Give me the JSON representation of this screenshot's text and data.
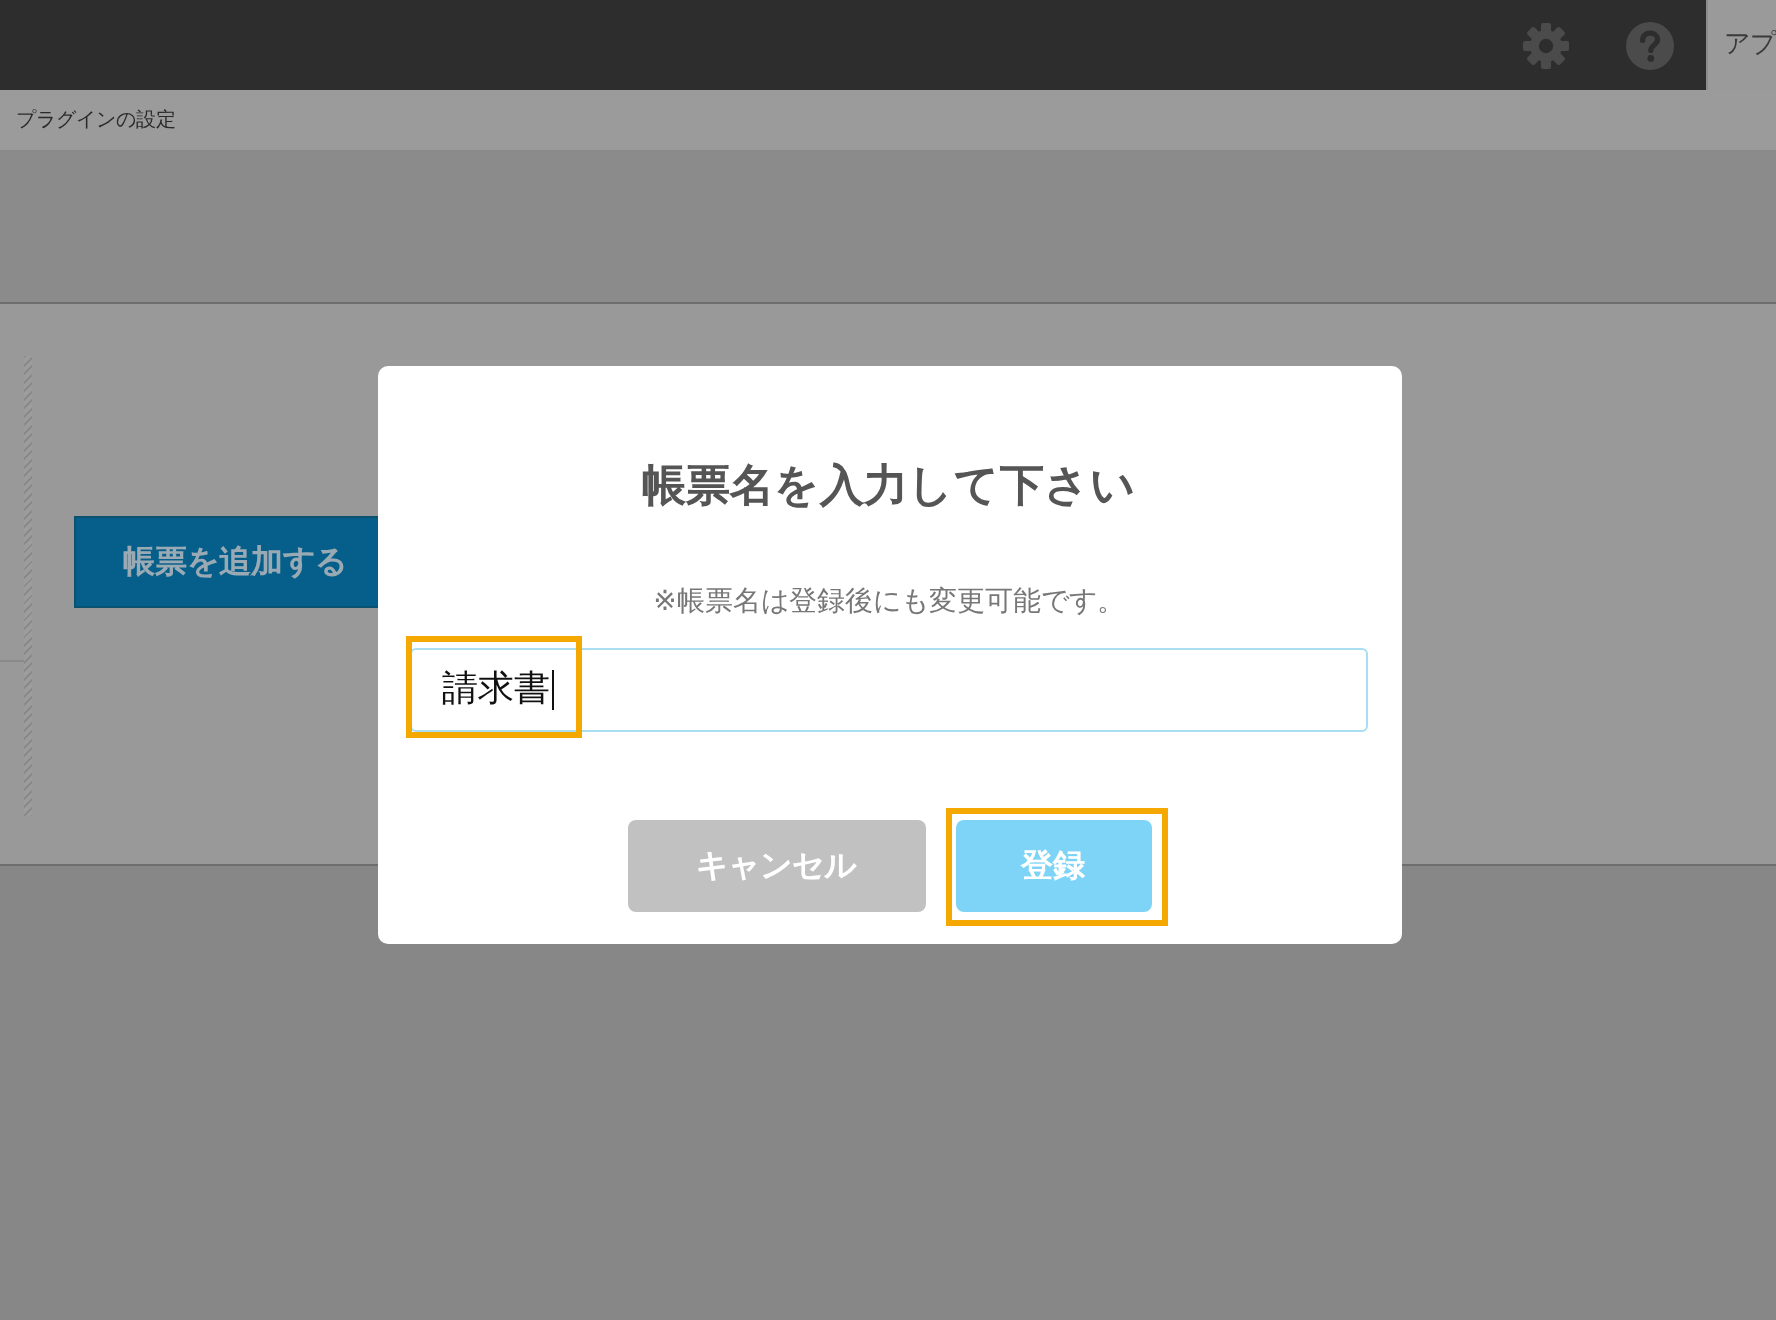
{
  "header": {
    "tab": "アプ"
  },
  "breadcrumb": "プラグインの設定",
  "page": {
    "add_button": "帳票を追加する"
  },
  "dialog": {
    "title": "帳票名を入力して下さい",
    "note": "※帳票名は登録後にも変更可能です。",
    "input": {
      "value": "請求書",
      "focused": true,
      "highlighted": true
    },
    "buttons": [
      {
        "label": "キャンセル",
        "kind": "cancel",
        "highlighted": false
      },
      {
        "label": "登録",
        "kind": "primary",
        "highlighted": true
      }
    ]
  }
}
